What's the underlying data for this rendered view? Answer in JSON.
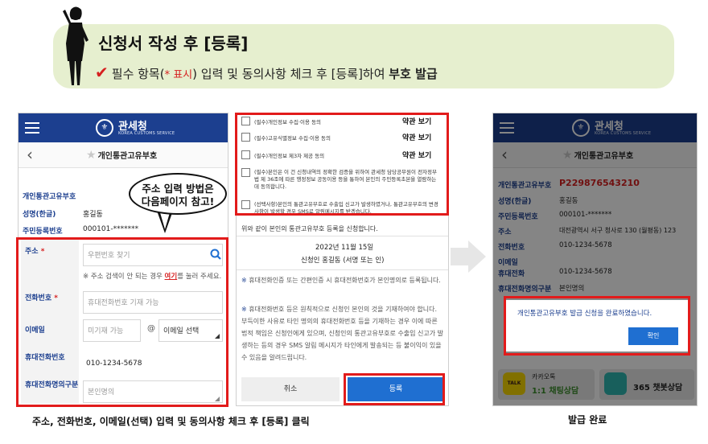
{
  "banner": {
    "title": "신청서 작성 후 [등록]",
    "sub_a": "필수 항목(",
    "sub_req": "* 표시",
    "sub_b": ") 입력 및  동의사항  체크 후 [등록]하여 ",
    "sub_c": "부호 발급"
  },
  "header": {
    "logo_name": "관세청",
    "logo_en": "KOREA CUSTOMS SERVICE",
    "page_title": "개인통관고유부호"
  },
  "form": {
    "code_label": "개인통관고유부호",
    "name_label": "성명(한글)",
    "name_value": "홍길동",
    "rrn_label": "주민등록번호",
    "rrn_value": "000101-*******",
    "address_label": "주소",
    "address_placeholder": "우편번호 찾기",
    "address_hint_a": "※ 주소 검색이 안 되는 경우 ",
    "address_hint_link": "여기",
    "address_hint_b": "를 눌러 주세요.",
    "phone_label": "전화번호",
    "phone_placeholder": "휴대전화번호 기재 가능",
    "email_label": "이메일",
    "email_placeholder": "미기재 가능",
    "email_at": "@",
    "email_domain": "이메일 선택",
    "mobile_label": "휴대전화번호",
    "mobile_value": "010-1234-5678",
    "owner_label": "휴대전화명의구분",
    "owner_placeholder": "본인명의"
  },
  "bubble": {
    "line1": "주소 입력 방법은",
    "line2": "다음페이지 참고!"
  },
  "consent": {
    "items": [
      "(필수)개인정보 수집·이용 동의",
      "(필수)고유식별정보 수집·이용 동의",
      "(필수)개인정보 제3자 제공 동의"
    ],
    "terms_label": "약관 보기",
    "item4": "(필수)본인은 이 건 신청내역의 정확한 검증을 위하여 관세청 담당공무원이 전자정부법 제 36조에 따른 행정정보 공동이용 등을 통하여 본인의 주민등록초본을 열람하는데 동의합니다.",
    "item5": "(선택사항)본인의 통관고유부호로 수출입 신고가 발생하였거나, 통관고유부호의 변경사항이 발생할 경우 SMS로 알림메시지를 받겠습니다.",
    "apply_text": "위와 같이 본인의 통관고유부호 등록을 신청합니다.",
    "date": "2022년 11월 15일",
    "signer": "신청인 홍길동 (서명 또는 인)",
    "note1": "휴대전화인증 또는 간편인증 시 휴대전화번호가 본인명의로 등록됩니다.",
    "note2": "휴대전화번호 등은 원칙적으로 신청인 본인의 것을 기재하여야 합니다. 부득이한 사유로 타인 명의의 휴대전화번호 등을 기재하는 경우 이에 따른 법적 책임은 신청인에게 있으며, 신청인의 통관고유부호로 수출입 신고가 발생하는 등의 경우 SMS 알림 메시지가 타인에게 발송되는 등 불이익이 있을 수 있음을 알려드립니다.",
    "cancel": "취소",
    "register": "등록"
  },
  "result": {
    "code_value": "P229876543210",
    "address_value": "대전광역시 서구 청사로 130 (월평동) 123",
    "phone_value": "010-1234-5678",
    "mobile_label": "휴대전화",
    "owner_value": "본인명의",
    "modal_text": "개인통관고유부호 발급 신청을 완료하였습니다.",
    "confirm": "확인",
    "kakao_label": "카카오톡",
    "kakao_sub": "1:1 채팅상담",
    "kakao_logo": "TALK",
    "chatbot_label": "365 챗봇상담"
  },
  "captions": {
    "left": "주소, 전화번호, 이메일(선택) 입력  및  동의사항 체크 후 [등록] 클릭",
    "right": "발급 완료"
  },
  "colors": {
    "navy": "#1c3f8f",
    "red": "#e21b1b",
    "blue": "#1f6fd1",
    "banner": "#e6efcf"
  }
}
